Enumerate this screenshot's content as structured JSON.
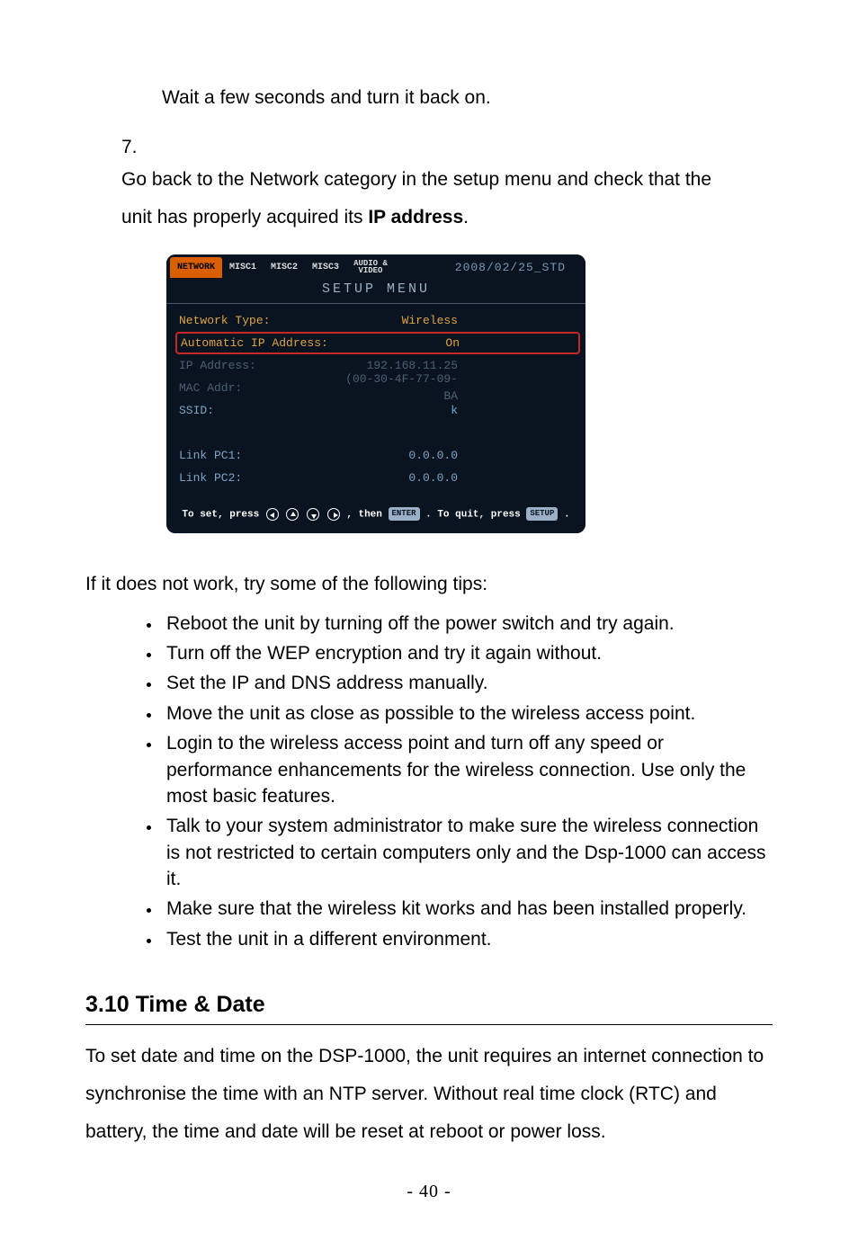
{
  "step6": {
    "text": "Wait a few seconds and turn it back on."
  },
  "step7": {
    "number": "7.",
    "text_a": "Go back to the Network category in the setup menu and check that the unit has properly acquired its ",
    "text_b": "IP address",
    "text_c": "."
  },
  "setup": {
    "tabs": [
      "NETWORK",
      "MISC1",
      "MISC2",
      "MISC3",
      "AUDIO &\nVIDEO"
    ],
    "date": "2008/02/25_STD",
    "title": "SETUP MENU",
    "rows": [
      {
        "label": "Network Type:",
        "value": "Wireless",
        "cls": "row-wireless"
      },
      {
        "label": "Automatic IP Address:",
        "value": "On",
        "cls": "row-highlight"
      },
      {
        "label": "IP Address:",
        "value": "192.168.11.25",
        "cls": "row-dim"
      },
      {
        "label": "MAC Addr:",
        "value": "(00-30-4F-77-09-BA",
        "cls": "row-dim"
      },
      {
        "label": "SSID:",
        "value": "k",
        "cls": "row-ssid"
      },
      {
        "label": "",
        "value": "",
        "cls": ""
      },
      {
        "label": "Link PC1:",
        "value": "0.0.0.0",
        "cls": "row-link"
      },
      {
        "label": "Link PC2:",
        "value": "0.0.0.0",
        "cls": "row-link"
      }
    ],
    "hint_a": "To set, press",
    "hint_then": ", then",
    "hint_enter": "ENTER",
    "hint_quit": ". To quit, press",
    "hint_setup": "SETUP",
    "hint_end": "."
  },
  "tips_intro": "If it does not work, try some of the following tips:",
  "tips": [
    "Reboot the unit by turning off the power switch and try again.",
    "Turn off the WEP encryption and try it again without.",
    "Set the IP and DNS address manually.",
    "Move the unit as close as possible to the wireless access point.",
    "Login to the wireless access point and turn off any speed or performance enhancements for the wireless connection. Use only the most basic features.",
    "Talk to your system administrator to make sure the wireless connection is not restricted to certain computers only and the Dsp-1000 can access it.",
    "Make sure that the wireless kit works and has been installed properly.",
    "Test the unit in a different environment."
  ],
  "section": {
    "heading": "3.10 Time & Date",
    "body": "To set date and time on the DSP-1000, the unit requires an internet connection to synchronise the time with an NTP server. Without real time clock (RTC) and battery, the time and date will be reset at reboot or power loss."
  },
  "page_number": "- 40 -"
}
